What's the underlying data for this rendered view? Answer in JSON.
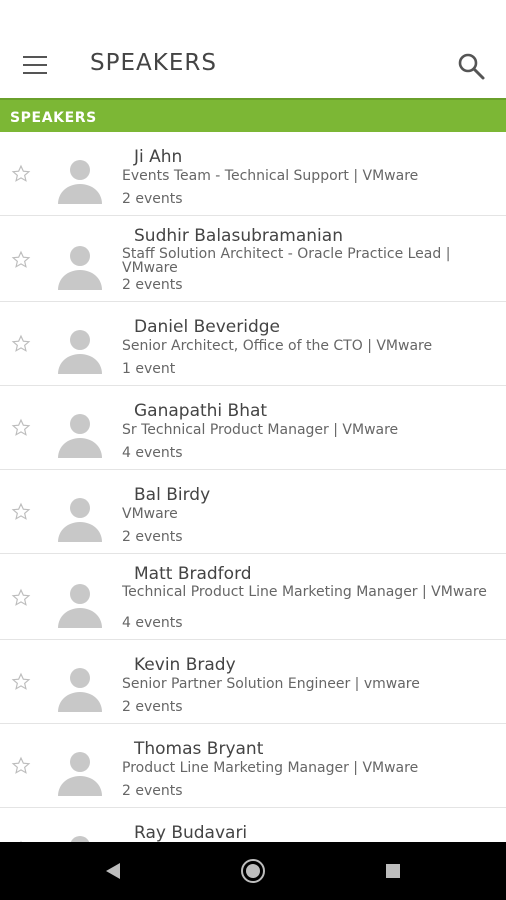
{
  "app_bar": {
    "title": "SPEAKERS",
    "menu_icon": "hamburger-menu-icon",
    "search_icon": "search-icon"
  },
  "section": {
    "header": "SPEAKERS",
    "color": "#7cb735"
  },
  "speakers": [
    {
      "name": "Ji Ahn",
      "title": "Events Team - Technical Support | VMware",
      "events": "2 events"
    },
    {
      "name": "Sudhir Balasubramanian",
      "title": "Staff Solution Architect - Oracle Practice Lead | VMware",
      "events": "2 events"
    },
    {
      "name": "Daniel Beveridge",
      "title": "Senior Architect, Office of the CTO | VMware",
      "events": "1 event"
    },
    {
      "name": "Ganapathi Bhat",
      "title": "Sr Technical Product Manager | VMware",
      "events": "4 events"
    },
    {
      "name": "Bal Birdy",
      "title": "VMware",
      "events": "2 events"
    },
    {
      "name": "Matt Bradford",
      "title": "Technical Product Line Marketing Manager | VMware",
      "events": "4 events"
    },
    {
      "name": "Kevin Brady",
      "title": "Senior Partner Solution Engineer | vmware",
      "events": "2 events"
    },
    {
      "name": "Thomas Bryant",
      "title": "Product Line Marketing Manager | VMware",
      "events": "2 events"
    },
    {
      "name": "Ray Budavari",
      "title": "",
      "events": ""
    }
  ],
  "nav": {
    "back_icon": "back-triangle-icon",
    "home_icon": "home-circle-icon",
    "recents_icon": "recents-square-icon"
  }
}
